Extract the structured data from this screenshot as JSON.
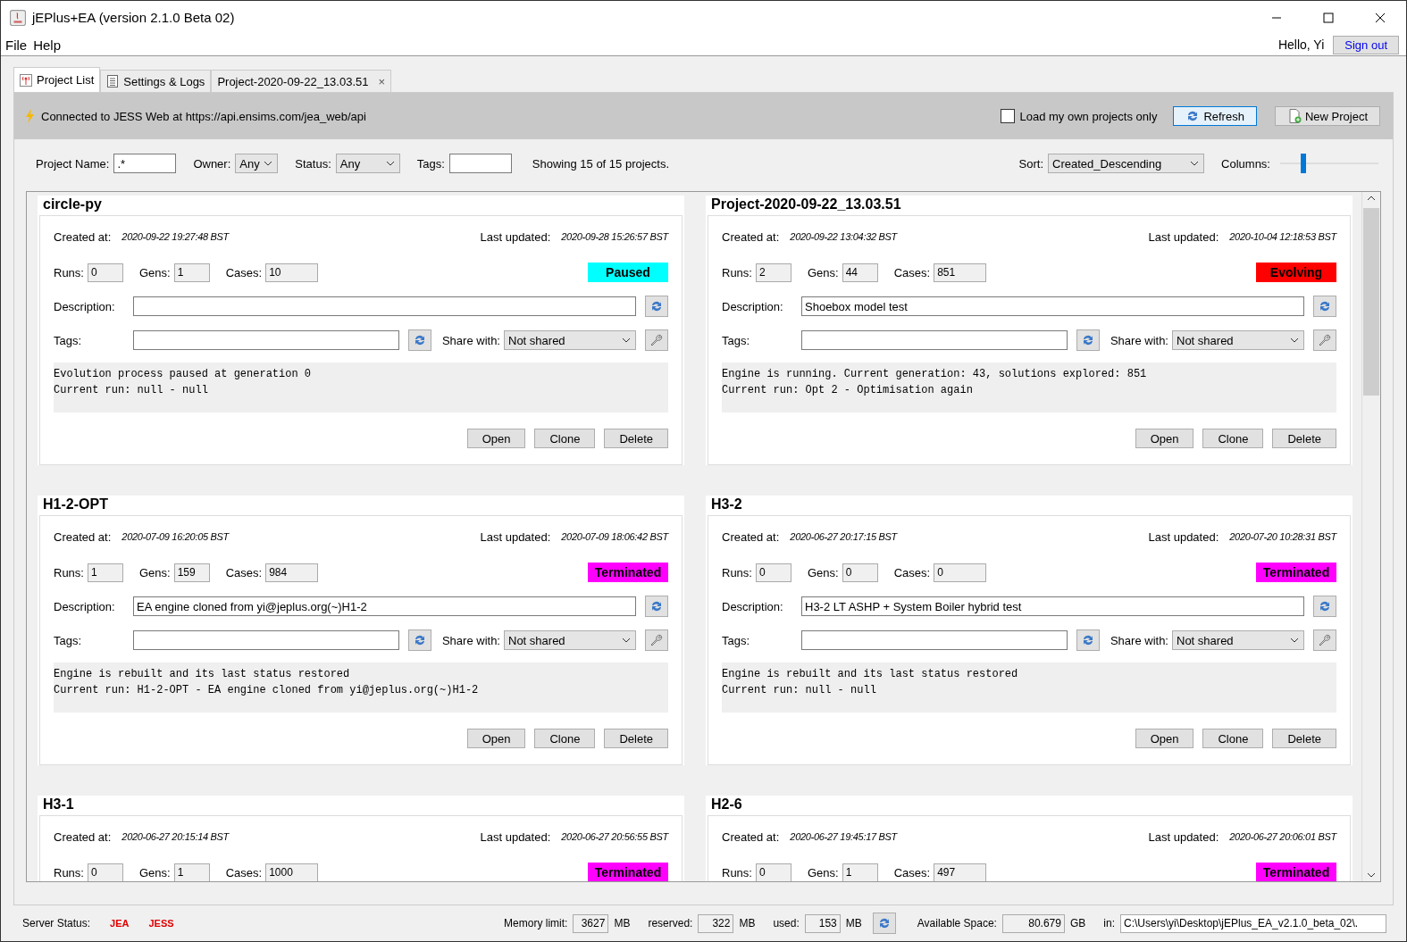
{
  "window": {
    "title": "jEPlus+EA (version 2.1.0 Beta 02)"
  },
  "menu": [
    "File",
    "Help"
  ],
  "user": {
    "greeting": "Hello, Yi",
    "sign_out": "Sign out"
  },
  "tabs": [
    {
      "label": "Project List",
      "selected": true
    },
    {
      "label": "Settings & Logs",
      "selected": false
    },
    {
      "label": "Project-2020-09-22_13.03.51",
      "selected": false,
      "close": "×"
    }
  ],
  "toolbar": {
    "connection": "Connected to JESS Web at https://api.ensims.com/jea_web/api",
    "own_only": {
      "label": "Load my own projects only",
      "checked": false
    },
    "refresh": "Refresh",
    "new_project": "New Project"
  },
  "filters": {
    "name_label": "Project Name:",
    "name_value": ".*",
    "owner_label": "Owner:",
    "owner_value": "Any",
    "status_label": "Status:",
    "status_value": "Any",
    "tags_label": "Tags:",
    "showing": "Showing 15 of 15 projects.",
    "sort_label": "Sort:",
    "sort_value": "Created_Descending",
    "columns_label": "Columns:",
    "columns_slider": {
      "level": 0.24
    }
  },
  "projects": [
    {
      "name": "circle-py",
      "labels": {
        "created": "Created at:",
        "updated": "Last updated:",
        "runs": "Runs:",
        "gens": "Gens:",
        "cases": "Cases:",
        "description": "Description:",
        "tags": "Tags:",
        "share": "Share with:"
      },
      "created": "2020-09-22 19:27:48 BST",
      "updated": "2020-09-28 15:26:57 BST",
      "runs": "0",
      "gens": "1",
      "cases": "10",
      "status": "Paused",
      "color": "#00ffff",
      "share": "Not shared",
      "log": [
        "Evolution process paused at generation 0",
        "Current run: null - null"
      ],
      "buttons": [
        "Open",
        "Clone",
        "Delete"
      ]
    },
    {
      "name": "Project-2020-09-22_13.03.51",
      "labels": {
        "created": "Created at:",
        "updated": "Last updated:",
        "runs": "Runs:",
        "gens": "Gens:",
        "cases": "Cases:",
        "description": "Description:",
        "tags": "Tags:",
        "share": "Share with:"
      },
      "created": "2020-09-22 13:04:32 BST",
      "updated": "2020-10-04 12:18:53 BST",
      "runs": "2",
      "gens": "44",
      "cases": "851",
      "status": "Evolving",
      "color": "#ff0000",
      "description": "Shoebox model test",
      "share": "Not shared",
      "log": [
        "Engine is running. Current generation: 43, solutions explored: 851",
        "Current run: Opt 2 - Optimisation again"
      ],
      "buttons": [
        "Open",
        "Clone",
        "Delete"
      ]
    },
    {
      "name": "H1-2-OPT",
      "labels": {
        "created": "Created at:",
        "updated": "Last updated:",
        "runs": "Runs:",
        "gens": "Gens:",
        "cases": "Cases:",
        "description": "Description:",
        "tags": "Tags:",
        "share": "Share with:"
      },
      "created": "2020-07-09 16:20:05 BST",
      "updated": "2020-07-09 18:06:42 BST",
      "runs": "1",
      "gens": "159",
      "cases": "984",
      "status": "Terminated",
      "color": "#ff00ff",
      "description": "EA engine cloned from yi@jeplus.org(~)H1-2",
      "share": "Not shared",
      "log": [
        "Engine is rebuilt and its last status restored",
        "Current run: H1-2-OPT - EA engine cloned from yi@jeplus.org(~)H1-2"
      ],
      "buttons": [
        "Open",
        "Clone",
        "Delete"
      ]
    },
    {
      "name": "H3-2",
      "labels": {
        "created": "Created at:",
        "updated": "Last updated:",
        "runs": "Runs:",
        "gens": "Gens:",
        "cases": "Cases:",
        "description": "Description:",
        "tags": "Tags:",
        "share": "Share with:"
      },
      "created": "2020-06-27 20:17:15 BST",
      "updated": "2020-07-20 10:28:31 BST",
      "runs": "0",
      "gens": "0",
      "cases": "0",
      "status": "Terminated",
      "color": "#ff00ff",
      "description": "H3-2 LT ASHP + System Boiler hybrid test",
      "share": "Not shared",
      "log": [
        "Engine is rebuilt and its last status restored",
        "Current run: null - null"
      ],
      "buttons": [
        "Open",
        "Clone",
        "Delete"
      ]
    },
    {
      "name": "H3-1",
      "labels": {
        "created": "Created at:",
        "updated": "Last updated:",
        "runs": "Runs:",
        "gens": "Gens:",
        "cases": "Cases:"
      },
      "created": "2020-06-27 20:15:14 BST",
      "updated": "2020-06-27 20:56:55 BST",
      "runs": "0",
      "gens": "1",
      "cases": "1000",
      "status": "Terminated",
      "color": "#ff00ff"
    },
    {
      "name": "H2-6",
      "labels": {
        "created": "Created at:",
        "updated": "Last updated:",
        "runs": "Runs:",
        "gens": "Gens:",
        "cases": "Cases:"
      },
      "created": "2020-06-27 19:45:17 BST",
      "updated": "2020-06-27 20:06:01 BST",
      "runs": "0",
      "gens": "1",
      "cases": "497",
      "status": "Terminated",
      "color": "#ff00ff"
    }
  ],
  "status_bar": {
    "server_label": "Server Status:",
    "servers": [
      "JEA",
      "JESS"
    ],
    "memory_label": "Memory limit:",
    "memory": "3627",
    "memory_unit": "MB",
    "reserved_label": "reserved:",
    "reserved": "322",
    "reserved_unit": "MB",
    "used_label": "used:",
    "used": "153",
    "used_unit": "MB",
    "space_label": "Available Space:",
    "space": "80.679",
    "space_unit": "GB",
    "in_label": "in:",
    "path": "C:\\Users\\yi\\Desktop\\jEPlus_EA_v2.1.0_beta_02\\."
  }
}
